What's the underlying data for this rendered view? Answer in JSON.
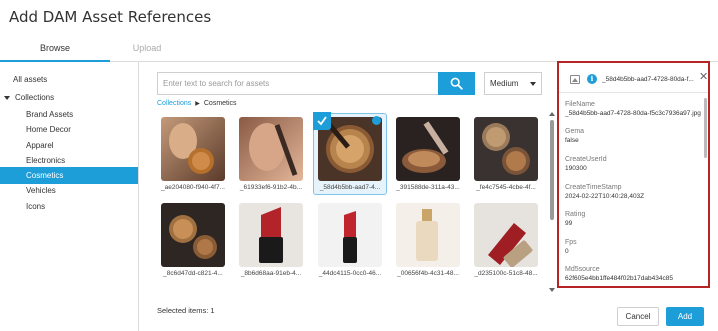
{
  "dialog": {
    "title": "Add DAM Asset References"
  },
  "tabs": [
    {
      "label": "Browse"
    },
    {
      "label": "Upload"
    }
  ],
  "sidebar": {
    "items": [
      {
        "label": "All assets"
      },
      {
        "label": "Collections"
      },
      {
        "label": "Brand Assets"
      },
      {
        "label": "Home Decor"
      },
      {
        "label": "Apparel"
      },
      {
        "label": "Electronics"
      },
      {
        "label": "Cosmetics"
      },
      {
        "label": "Vehicles"
      },
      {
        "label": "Icons"
      }
    ]
  },
  "search": {
    "placeholder": "Enter text to search for assets",
    "button_icon": "search-icon"
  },
  "size_select": {
    "value": "Medium"
  },
  "breadcrumb": {
    "root": "Collections",
    "current": "Cosmetics"
  },
  "grid": {
    "selected_index": 2,
    "assets": [
      {
        "caption": "_ae204080-f940-4f7..."
      },
      {
        "caption": "_61933ef6-91b2-4b..."
      },
      {
        "caption": "_58d4b5bb-aad7-4..."
      },
      {
        "caption": "_391588de-311a-43..."
      },
      {
        "caption": "_fe4c7545-4cbe-4f..."
      },
      {
        "caption": "_8c6d47dd-c821-4..."
      },
      {
        "caption": "_8b6d68aa-91eb-4..."
      },
      {
        "caption": "_44dc4115-0cc0-46..."
      },
      {
        "caption": "_00656f4b-4c31-48..."
      },
      {
        "caption": "_d235100c-51c8-48..."
      }
    ]
  },
  "footer": {
    "selected_label": "Selected items: 1",
    "cancel_label": "Cancel",
    "add_label": "Add"
  },
  "details": {
    "title": "_58d4b5bb-aad7-4728-80da-f...",
    "fields": [
      {
        "label": "FileName",
        "value": "_58d4b5bb-aad7-4728-80da-f5c3c7936a97.jpg"
      },
      {
        "label": "Gema",
        "value": "false"
      },
      {
        "label": "CreateUserId",
        "value": "190300"
      },
      {
        "label": "CreateTimeStamp",
        "value": "2024-02-22T10:40:28,403Z"
      },
      {
        "label": "Rating",
        "value": "99"
      },
      {
        "label": "Fps",
        "value": "0"
      },
      {
        "label": "Md5source",
        "value": "62f605e4bb1ffe484f02b17dab434c85"
      }
    ]
  },
  "colors": {
    "accent": "#1e9ed9",
    "highlight_border": "#b62426"
  }
}
